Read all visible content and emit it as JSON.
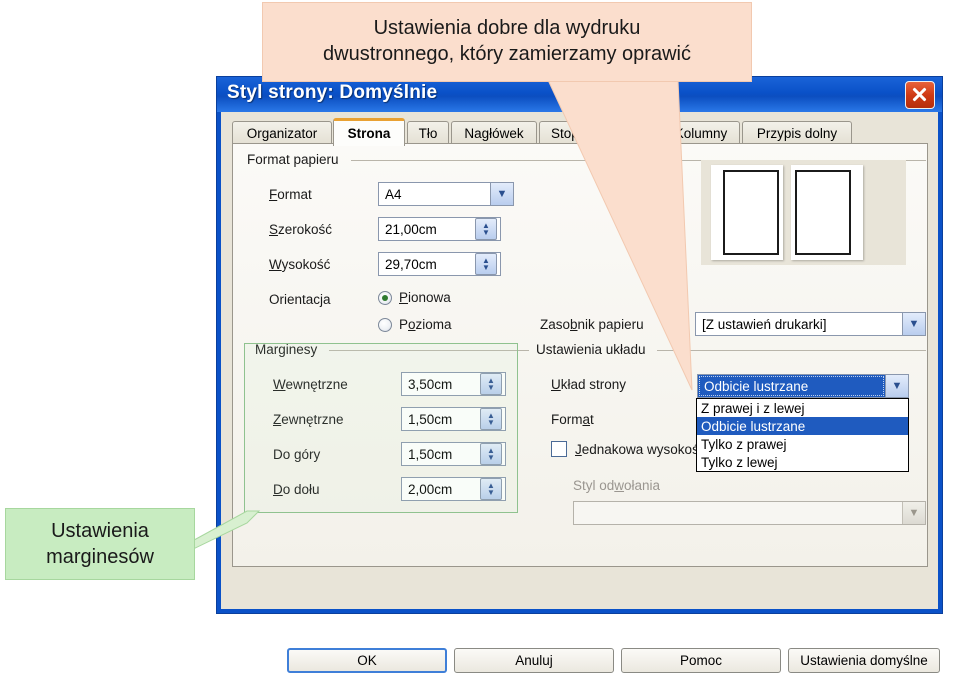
{
  "dialog": {
    "title": "Styl strony: Domyślnie",
    "close_icon": "close-icon",
    "tabs": [
      {
        "label": "Organizator",
        "active": false
      },
      {
        "label": "Strona",
        "active": true
      },
      {
        "label": "Tło",
        "active": false
      },
      {
        "label": "Nagłówek",
        "active": false
      },
      {
        "label": "Stopka",
        "active": false
      },
      {
        "label": "Kolumny",
        "active": false
      },
      {
        "label": "Przypis dolny",
        "active": false
      }
    ],
    "buttons": [
      {
        "label": "OK",
        "default": true
      },
      {
        "label": "Anuluj",
        "default": false
      },
      {
        "label": "Pomoc",
        "default": false
      },
      {
        "label": "Ustawienia domyślne",
        "default": false
      }
    ]
  },
  "paper_format": {
    "group_label": "Format papieru",
    "format_label": "Format",
    "format_value": "A4",
    "width_label": "Szerokość",
    "width_value": "21,00cm",
    "height_label": "Wysokość",
    "height_value": "29,70cm",
    "orientation_label": "Orientacja",
    "portrait_label": "Pionowa",
    "landscape_label": "Pozioma",
    "orientation_selected": "Pionowa",
    "tray_label": "Zasobnik papieru",
    "tray_value": "[Z ustawień drukarki]"
  },
  "margins": {
    "group_label": "Marginesy",
    "inner_label": "Wewnętrzne",
    "inner_value": "3,50cm",
    "outer_label": "Zewnętrzne",
    "outer_value": "1,50cm",
    "top_label": "Do góry",
    "top_value": "1,50cm",
    "bottom_label": "Do dołu",
    "bottom_value": "2,00cm"
  },
  "layout_settings": {
    "group_label": "Ustawienia układu",
    "page_layout_label": "Układ strony",
    "page_layout_value": "Odbicie lustrzane",
    "page_layout_options": [
      "Z prawej i z lewej",
      "Odbicie lustrzane",
      "Tylko z prawej",
      "Tylko z lewej"
    ],
    "format_label": "Format",
    "equal_height_label": "Jednakowa wysokość",
    "equal_height_checked": false,
    "ref_style_label": "Styl odwołania",
    "ref_style_value": ""
  },
  "callouts": {
    "top_line1": "Ustawienia dobre dla wydruku",
    "top_line2": "dwustronnego, który zamierzamy oprawić",
    "left_line1": "Ustawienia",
    "left_line2": "marginesów"
  },
  "colors": {
    "titlebar": "#0a51c8",
    "accent_tab": "#e9a132",
    "selection": "#1f5bbf",
    "callout_top_bg": "#fbdecd",
    "callout_left_bg": "#c8ecc1",
    "highlight_border": "#8fc28f",
    "close_button": "#cf3a15"
  }
}
